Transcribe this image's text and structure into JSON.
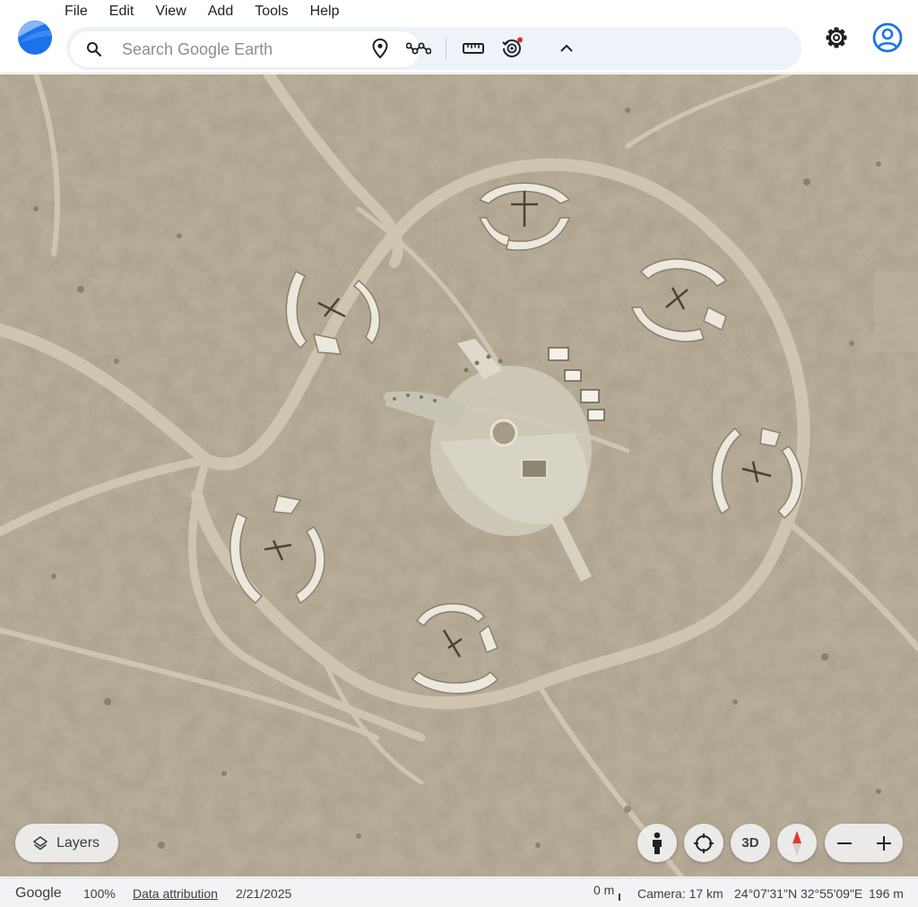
{
  "menu": [
    "File",
    "Edit",
    "View",
    "Add",
    "Tools",
    "Help"
  ],
  "search": {
    "placeholder": "Search Google Earth"
  },
  "toolbar": {
    "icons": [
      "placemark-icon",
      "path-icon",
      "ruler-icon",
      "historical-imagery-icon",
      "chevron-up-icon"
    ]
  },
  "controls": {
    "layers_label": "Layers",
    "three_d_label": "3D"
  },
  "status": {
    "brand": "Google",
    "zoom": "100%",
    "attribution": "Data attribution",
    "imagery_date": "2/21/2025",
    "scale": "0 m",
    "camera": "Camera: 17 km",
    "coordinates": "24°07'31\"N 32°55'09\"E",
    "elevation": "196 m"
  },
  "colors": {
    "accent_blue": "#1a73e8",
    "terrain": "#b7ac98",
    "notification_dot": "#d93025",
    "compass_red": "#e53935"
  }
}
